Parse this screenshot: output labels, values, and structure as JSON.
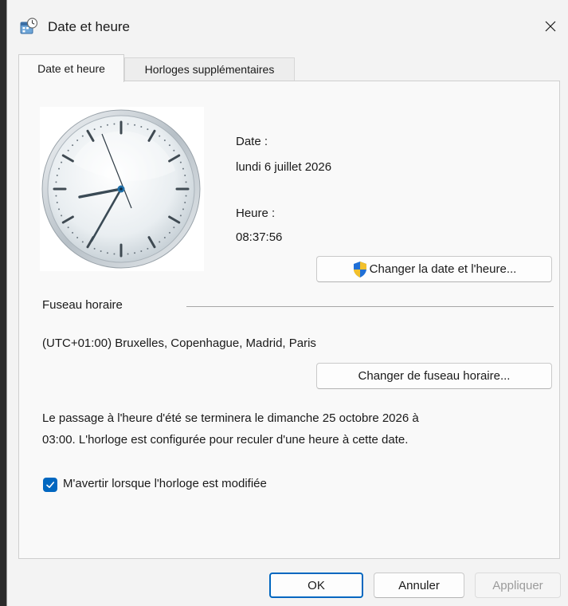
{
  "window": {
    "title": "Date et heure"
  },
  "tabs": [
    {
      "label": "Date et heure",
      "active": true
    },
    {
      "label": "Horloges supplémentaires",
      "active": false
    }
  ],
  "datetime": {
    "date_label": "Date :",
    "date_value": "lundi 6 juillet 2026",
    "time_label": "Heure :",
    "time_value": "08:37:56",
    "change_button": "Changer la date et l'heure..."
  },
  "timezone": {
    "section_label": "Fuseau horaire",
    "value": "(UTC+01:00) Bruxelles, Copenhague, Madrid, Paris",
    "change_button": "Changer de fuseau horaire..."
  },
  "dst": {
    "line1": "Le passage à l'heure d'été se terminera le dimanche 25 octobre 2026 à",
    "line2": "03:00. L'horloge est configurée pour reculer d'une heure à cette date."
  },
  "notify": {
    "label": "M'avertir lorsque l'horloge est modifiée",
    "checked": true
  },
  "buttons": {
    "ok": "OK",
    "cancel": "Annuler",
    "apply": "Appliquer"
  },
  "colors": {
    "accent": "#0067c0",
    "shield_blue": "#1f6fd6",
    "shield_yellow": "#f2c02c"
  }
}
